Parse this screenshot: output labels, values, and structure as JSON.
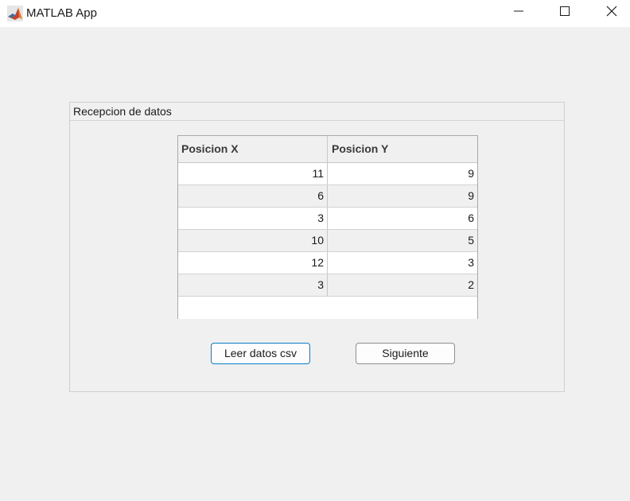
{
  "window": {
    "title": "MATLAB App",
    "icons": [
      "matlab-logo-icon",
      "minimize-icon",
      "maximize-icon",
      "close-icon"
    ]
  },
  "panel": {
    "title": "Recepcion de datos"
  },
  "table": {
    "columns": [
      "Posicion X",
      "Posicion Y"
    ],
    "rows": [
      [
        "11",
        "9"
      ],
      [
        "6",
        "9"
      ],
      [
        "3",
        "6"
      ],
      [
        "10",
        "5"
      ],
      [
        "12",
        "3"
      ],
      [
        "3",
        "2"
      ],
      [
        "",
        ""
      ]
    ]
  },
  "buttons": {
    "read_csv": "Leer datos csv",
    "next": "Siguiente"
  },
  "colors": {
    "background": "#f0f0f0",
    "focus_border": "#0a7dc4",
    "titlebar": "#ffffff"
  }
}
